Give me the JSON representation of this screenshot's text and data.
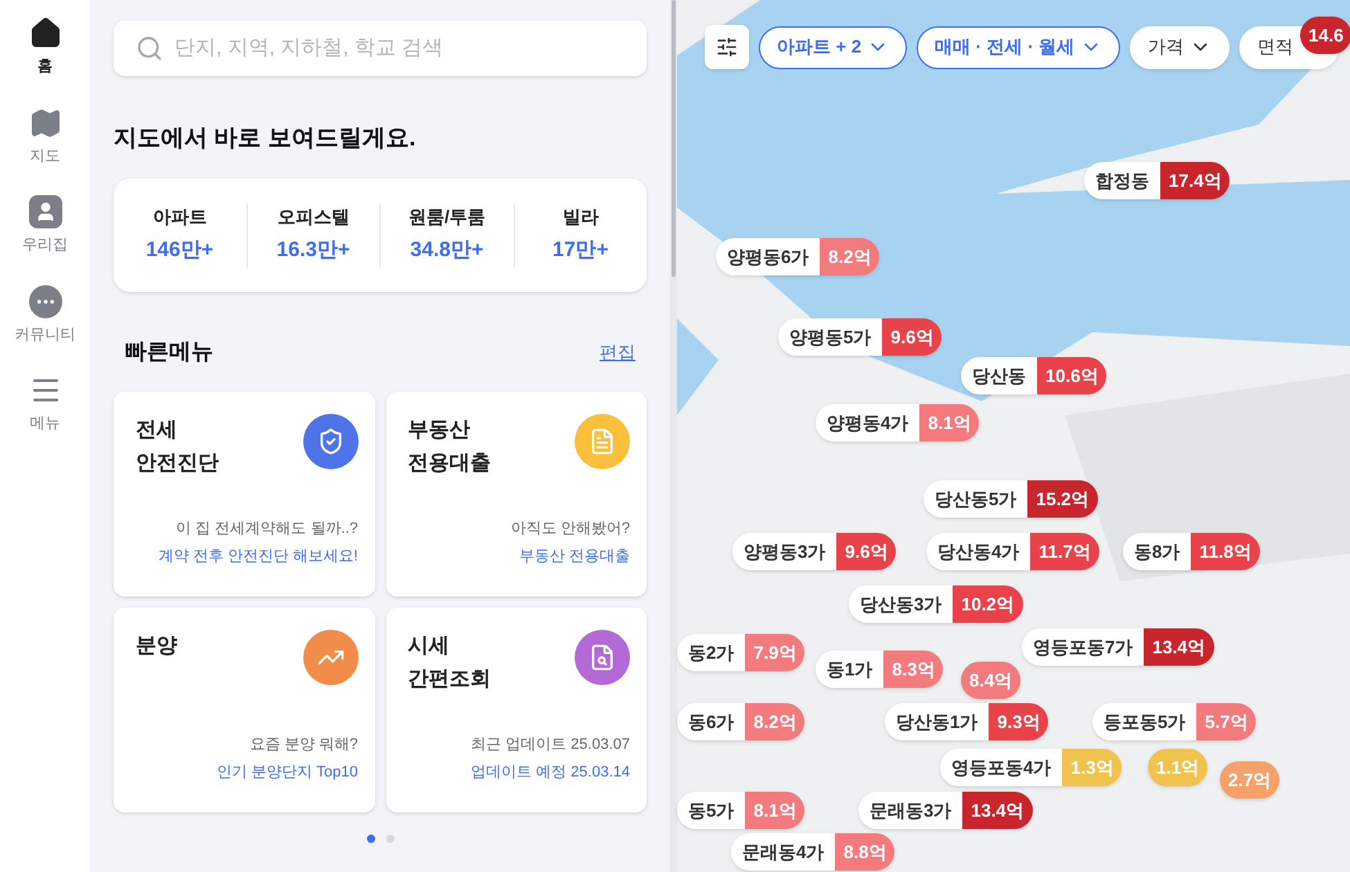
{
  "nav": [
    {
      "label": "홈",
      "selected": true
    },
    {
      "label": "지도",
      "selected": false
    },
    {
      "label": "우리집",
      "selected": false
    },
    {
      "label": "커뮤니티",
      "selected": false
    },
    {
      "label": "메뉴",
      "selected": false
    }
  ],
  "search": {
    "placeholder": "단지, 지역, 지하철, 학교 검색"
  },
  "heading": "지도에서 바로 보여드릴게요.",
  "stats": [
    {
      "label": "아파트",
      "value": "146만+"
    },
    {
      "label": "오피스텔",
      "value": "16.3만+"
    },
    {
      "label": "원룸/투룸",
      "value": "34.8만+"
    },
    {
      "label": "빌라",
      "value": "17만+"
    }
  ],
  "quick_menu": {
    "title": "빠른메뉴",
    "edit": "편집",
    "cards": [
      {
        "title": "전세\n안전진단",
        "hint": "이 집 전세계약해도 될까..?",
        "link": "계약 전후 안전진단 해보세요!"
      },
      {
        "title": "부동산\n전용대출",
        "hint": "아직도 안해봤어?",
        "link": "부동산 전용대출"
      },
      {
        "title": "분양",
        "hint": "요즘 분양 뭐해?",
        "link": "인기 분양단지 Top10"
      },
      {
        "title": "시세\n간편조회",
        "hint": "최근 업데이트 25.03.07",
        "link": "업데이트 예정 25.03.14"
      }
    ]
  },
  "pages": [
    {
      "selected": true
    },
    {
      "selected": false
    }
  ],
  "filters": [
    {
      "label": "아파트 + 2",
      "selected": true
    },
    {
      "label": "매매 · 전세 · 월세",
      "selected": true
    },
    {
      "label": "가격",
      "selected": false
    },
    {
      "label": "면적",
      "selected": false
    }
  ],
  "markers": [
    {
      "price": "14.6",
      "color": "#c9252c"
    },
    {
      "label": "합정동",
      "price": "17.4억",
      "color": "#c9252c"
    },
    {
      "label": "양평동6가",
      "price": "8.2억",
      "color": "#f37b7e"
    },
    {
      "label": "양평동5가",
      "price": "9.6억",
      "color": "#e8434a"
    },
    {
      "label": "당산동",
      "price": "10.6억",
      "color": "#e8434a"
    },
    {
      "label": "양평동4가",
      "price": "8.1억",
      "color": "#f37b7e"
    },
    {
      "label": "당산동5가",
      "price": "15.2억",
      "color": "#c9252c"
    },
    {
      "label": "양평동3가",
      "price": "9.6억",
      "color": "#e8434a"
    },
    {
      "label": "당산동4가",
      "price": "11.7억",
      "color": "#e8434a"
    },
    {
      "label": "동8가",
      "price": "11.8억",
      "color": "#e8434a"
    },
    {
      "label": "당산동3가",
      "price": "10.2억",
      "color": "#e8434a"
    },
    {
      "label": "동2가",
      "price": "7.9억",
      "color": "#f37b7e"
    },
    {
      "label": "영등포동7가",
      "price": "13.4억",
      "color": "#c9252c"
    },
    {
      "label": "동1가",
      "price": "8.3억",
      "color": "#f37b7e"
    },
    {
      "price": "8.4억",
      "color": "#f37b7e"
    },
    {
      "label": "동6가",
      "price": "8.2억",
      "color": "#f37b7e"
    },
    {
      "label": "당산동1가",
      "price": "9.3억",
      "color": "#e8434a"
    },
    {
      "label": "등포동5가",
      "price": "5.7억",
      "color": "#f37b7e"
    },
    {
      "label": "영등포동4가",
      "price": "1.3억",
      "color": "#f0c24e"
    },
    {
      "price": "1.1억",
      "color": "#f0c24e"
    },
    {
      "price": "2.7억",
      "color": "#f6a06a"
    },
    {
      "label": "동5가",
      "price": "8.1억",
      "color": "#f37b7e"
    },
    {
      "label": "문래동3가",
      "price": "13.4억",
      "color": "#c9252c"
    },
    {
      "label": "문래동4가",
      "price": "8.8억",
      "color": "#f37b7e"
    }
  ]
}
